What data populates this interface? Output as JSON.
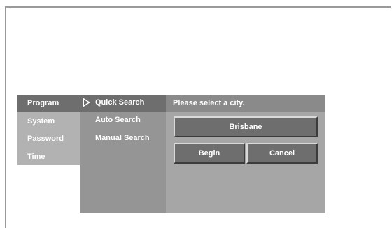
{
  "main_menu": {
    "items": [
      {
        "label": "Program",
        "active": true
      },
      {
        "label": "System",
        "active": false
      },
      {
        "label": "Password",
        "active": false
      },
      {
        "label": "Time",
        "active": false
      }
    ]
  },
  "sub_menu": {
    "items": [
      {
        "label": "Quick Search",
        "selected": true
      },
      {
        "label": "Auto Search",
        "selected": false
      },
      {
        "label": "Manual Search",
        "selected": false
      }
    ]
  },
  "panel": {
    "prompt": "Please select a city.",
    "city_value": "Brisbane",
    "begin_label": "Begin",
    "cancel_label": "Cancel"
  },
  "colors": {
    "active_bg": "#6e6e6e",
    "menu_bg": "#b2b2b2",
    "submenu_bg": "#959595",
    "panel_bg": "#a6a6a6",
    "text": "#ffffff"
  },
  "icons": {
    "selection": "play-arrow-icon"
  }
}
